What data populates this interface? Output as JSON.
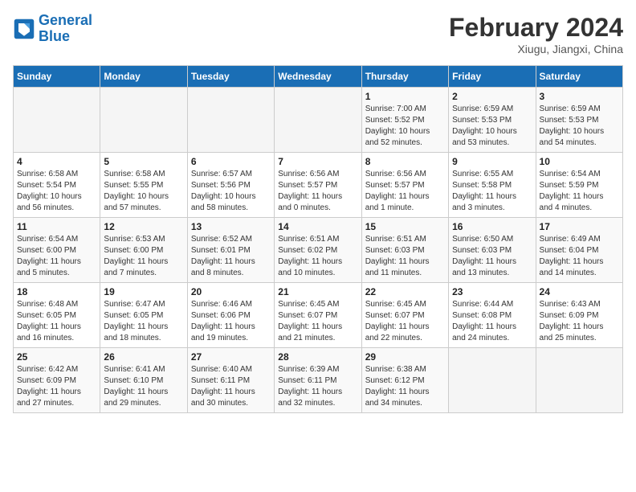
{
  "logo": {
    "line1": "General",
    "line2": "Blue"
  },
  "title": "February 2024",
  "subtitle": "Xiugu, Jiangxi, China",
  "weekdays": [
    "Sunday",
    "Monday",
    "Tuesday",
    "Wednesday",
    "Thursday",
    "Friday",
    "Saturday"
  ],
  "weeks": [
    [
      {
        "day": "",
        "info": ""
      },
      {
        "day": "",
        "info": ""
      },
      {
        "day": "",
        "info": ""
      },
      {
        "day": "",
        "info": ""
      },
      {
        "day": "1",
        "info": "Sunrise: 7:00 AM\nSunset: 5:52 PM\nDaylight: 10 hours\nand 52 minutes."
      },
      {
        "day": "2",
        "info": "Sunrise: 6:59 AM\nSunset: 5:53 PM\nDaylight: 10 hours\nand 53 minutes."
      },
      {
        "day": "3",
        "info": "Sunrise: 6:59 AM\nSunset: 5:53 PM\nDaylight: 10 hours\nand 54 minutes."
      }
    ],
    [
      {
        "day": "4",
        "info": "Sunrise: 6:58 AM\nSunset: 5:54 PM\nDaylight: 10 hours\nand 56 minutes."
      },
      {
        "day": "5",
        "info": "Sunrise: 6:58 AM\nSunset: 5:55 PM\nDaylight: 10 hours\nand 57 minutes."
      },
      {
        "day": "6",
        "info": "Sunrise: 6:57 AM\nSunset: 5:56 PM\nDaylight: 10 hours\nand 58 minutes."
      },
      {
        "day": "7",
        "info": "Sunrise: 6:56 AM\nSunset: 5:57 PM\nDaylight: 11 hours\nand 0 minutes."
      },
      {
        "day": "8",
        "info": "Sunrise: 6:56 AM\nSunset: 5:57 PM\nDaylight: 11 hours\nand 1 minute."
      },
      {
        "day": "9",
        "info": "Sunrise: 6:55 AM\nSunset: 5:58 PM\nDaylight: 11 hours\nand 3 minutes."
      },
      {
        "day": "10",
        "info": "Sunrise: 6:54 AM\nSunset: 5:59 PM\nDaylight: 11 hours\nand 4 minutes."
      }
    ],
    [
      {
        "day": "11",
        "info": "Sunrise: 6:54 AM\nSunset: 6:00 PM\nDaylight: 11 hours\nand 5 minutes."
      },
      {
        "day": "12",
        "info": "Sunrise: 6:53 AM\nSunset: 6:00 PM\nDaylight: 11 hours\nand 7 minutes."
      },
      {
        "day": "13",
        "info": "Sunrise: 6:52 AM\nSunset: 6:01 PM\nDaylight: 11 hours\nand 8 minutes."
      },
      {
        "day": "14",
        "info": "Sunrise: 6:51 AM\nSunset: 6:02 PM\nDaylight: 11 hours\nand 10 minutes."
      },
      {
        "day": "15",
        "info": "Sunrise: 6:51 AM\nSunset: 6:03 PM\nDaylight: 11 hours\nand 11 minutes."
      },
      {
        "day": "16",
        "info": "Sunrise: 6:50 AM\nSunset: 6:03 PM\nDaylight: 11 hours\nand 13 minutes."
      },
      {
        "day": "17",
        "info": "Sunrise: 6:49 AM\nSunset: 6:04 PM\nDaylight: 11 hours\nand 14 minutes."
      }
    ],
    [
      {
        "day": "18",
        "info": "Sunrise: 6:48 AM\nSunset: 6:05 PM\nDaylight: 11 hours\nand 16 minutes."
      },
      {
        "day": "19",
        "info": "Sunrise: 6:47 AM\nSunset: 6:05 PM\nDaylight: 11 hours\nand 18 minutes."
      },
      {
        "day": "20",
        "info": "Sunrise: 6:46 AM\nSunset: 6:06 PM\nDaylight: 11 hours\nand 19 minutes."
      },
      {
        "day": "21",
        "info": "Sunrise: 6:45 AM\nSunset: 6:07 PM\nDaylight: 11 hours\nand 21 minutes."
      },
      {
        "day": "22",
        "info": "Sunrise: 6:45 AM\nSunset: 6:07 PM\nDaylight: 11 hours\nand 22 minutes."
      },
      {
        "day": "23",
        "info": "Sunrise: 6:44 AM\nSunset: 6:08 PM\nDaylight: 11 hours\nand 24 minutes."
      },
      {
        "day": "24",
        "info": "Sunrise: 6:43 AM\nSunset: 6:09 PM\nDaylight: 11 hours\nand 25 minutes."
      }
    ],
    [
      {
        "day": "25",
        "info": "Sunrise: 6:42 AM\nSunset: 6:09 PM\nDaylight: 11 hours\nand 27 minutes."
      },
      {
        "day": "26",
        "info": "Sunrise: 6:41 AM\nSunset: 6:10 PM\nDaylight: 11 hours\nand 29 minutes."
      },
      {
        "day": "27",
        "info": "Sunrise: 6:40 AM\nSunset: 6:11 PM\nDaylight: 11 hours\nand 30 minutes."
      },
      {
        "day": "28",
        "info": "Sunrise: 6:39 AM\nSunset: 6:11 PM\nDaylight: 11 hours\nand 32 minutes."
      },
      {
        "day": "29",
        "info": "Sunrise: 6:38 AM\nSunset: 6:12 PM\nDaylight: 11 hours\nand 34 minutes."
      },
      {
        "day": "",
        "info": ""
      },
      {
        "day": "",
        "info": ""
      }
    ]
  ]
}
